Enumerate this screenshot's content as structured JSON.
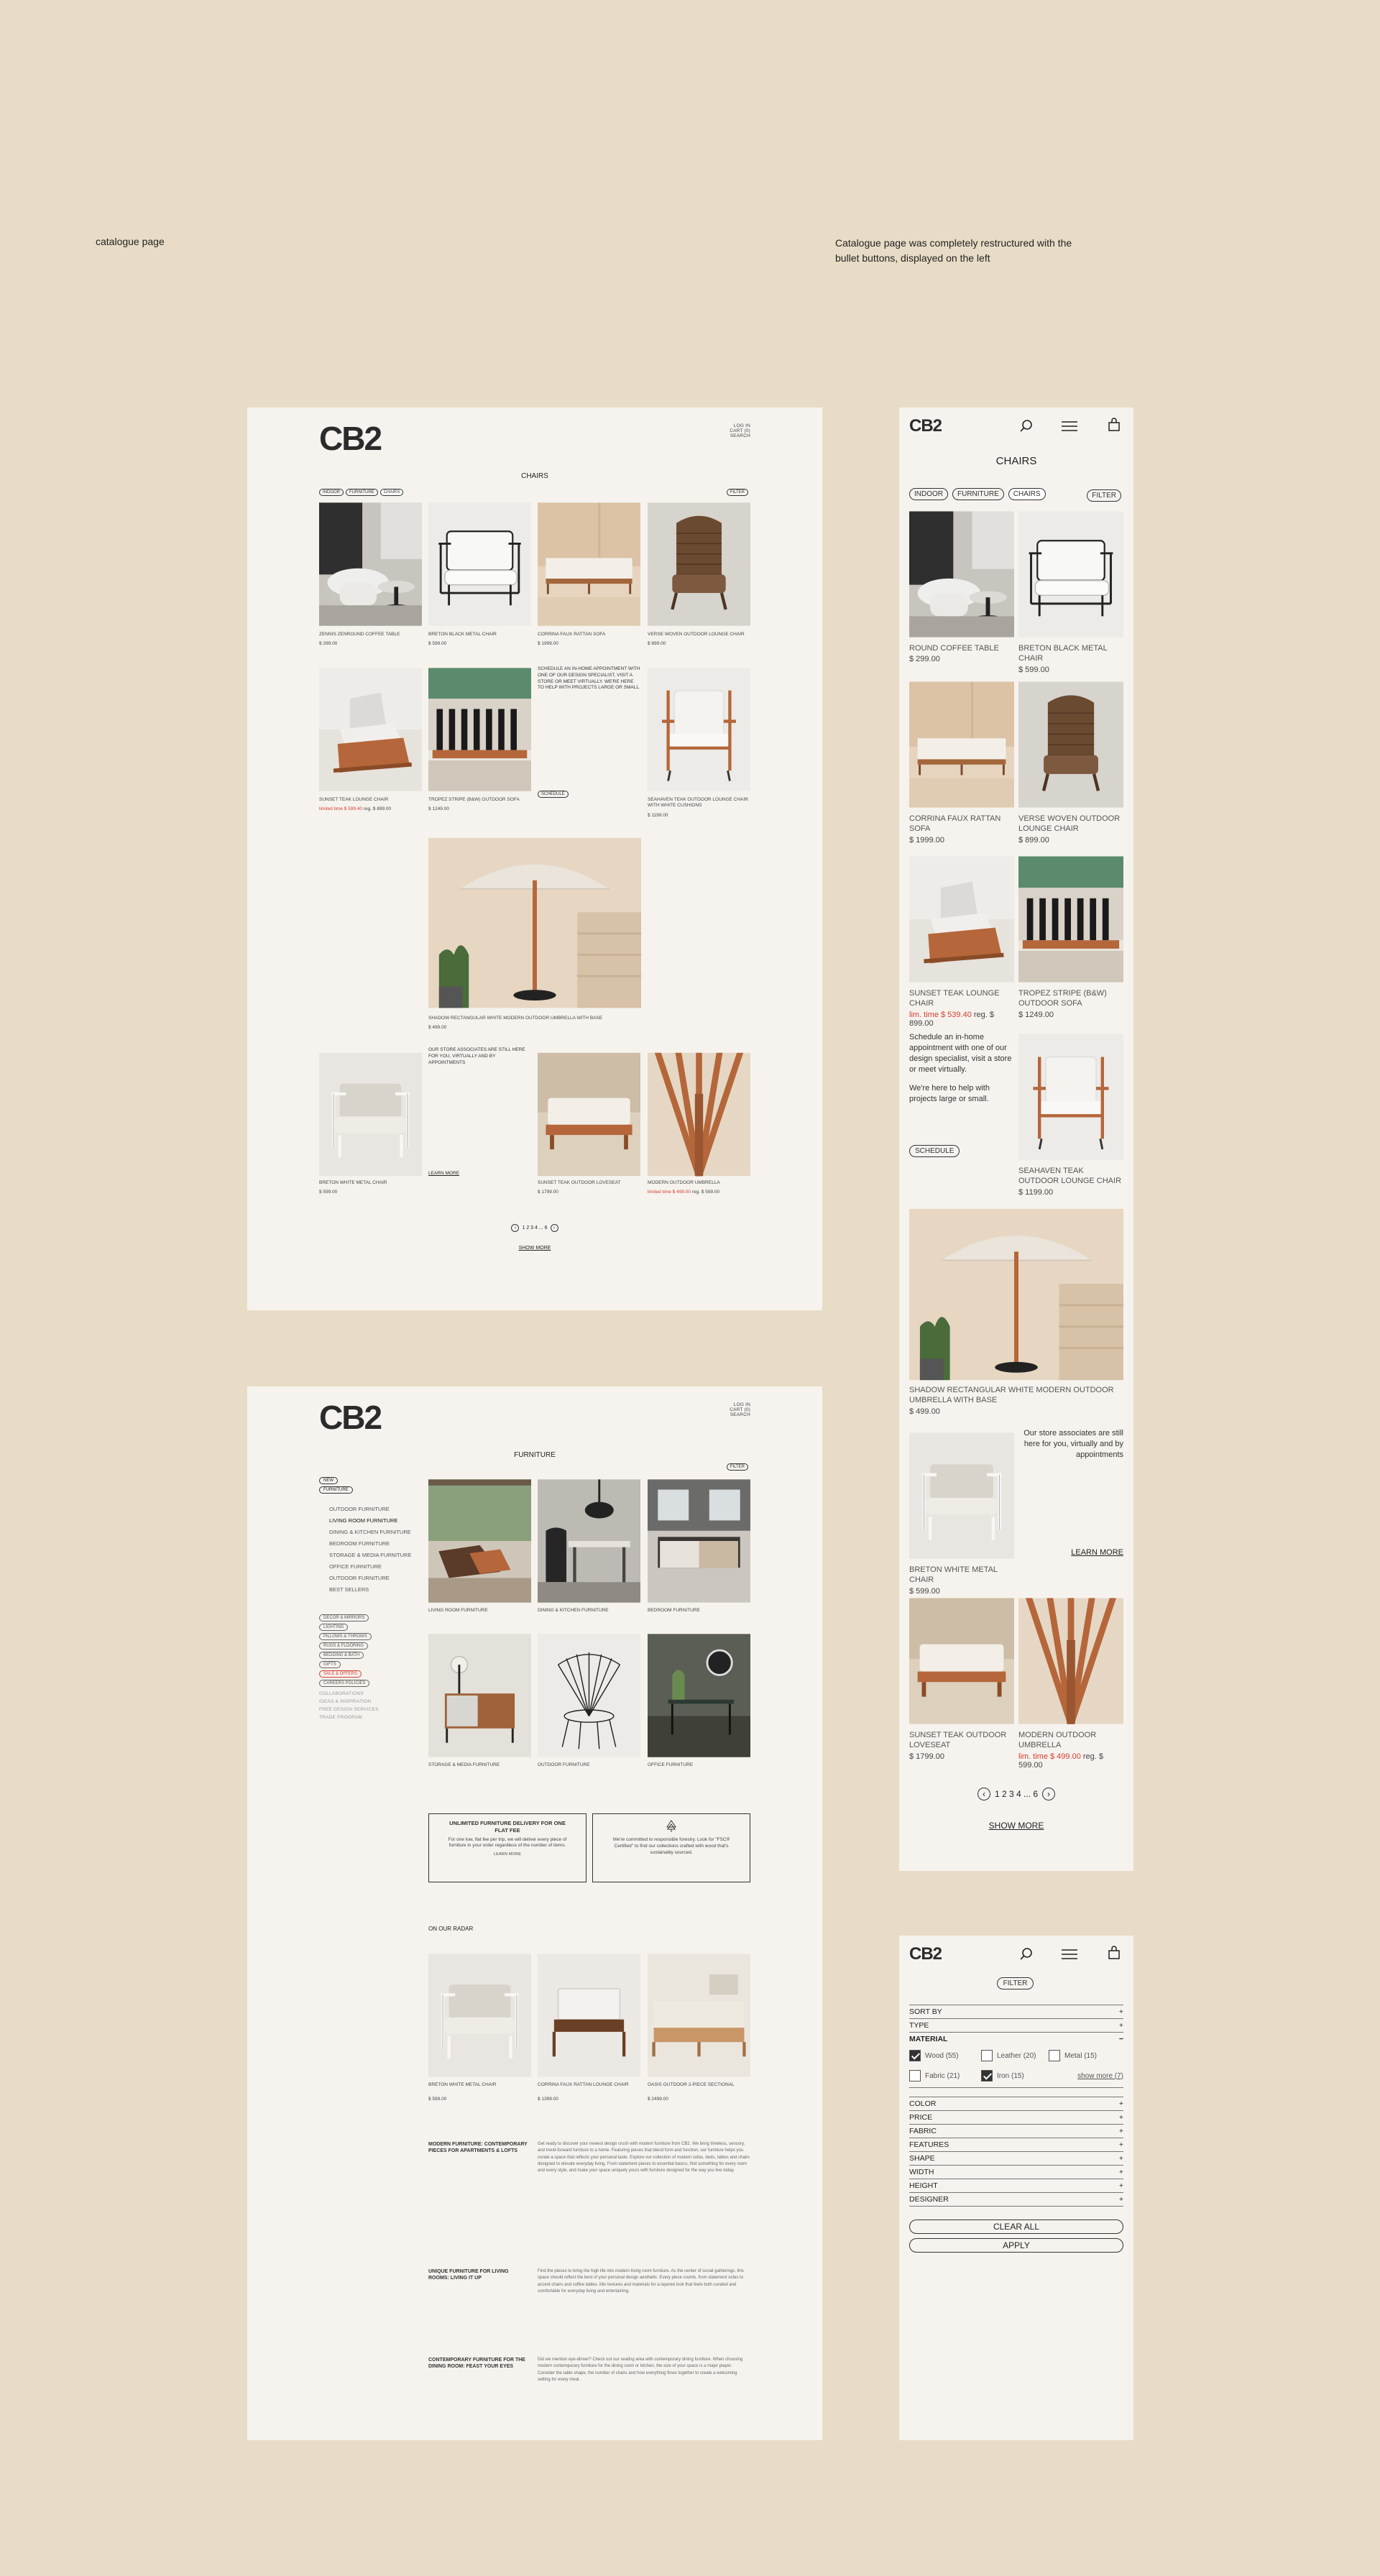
{
  "notes": {
    "left": "catalogue page",
    "right_line1": "Catalogue page was completely restructured with the",
    "right_line2": "bullet buttons, displayed on the left"
  },
  "brand": "CB2",
  "desktop1": {
    "top_links": [
      "LOG IN",
      "CART (0)",
      "SEARCH"
    ],
    "title": "CHAIRS",
    "chips": [
      "INDOOR",
      "FURNITURE",
      "CHAIRS"
    ],
    "filter_label": "FILTER",
    "products": [
      {
        "name": "ZENNIS ZENROUND COFFEE TABLE",
        "price": "$ 299.00"
      },
      {
        "name": "BRETON BLACK METAL CHAIR",
        "price": "$ 599.00"
      },
      {
        "name": "CORRINA FAUX RATTAN SOFA",
        "price": "$ 1999.00"
      },
      {
        "name": "VERSE WOVEN OUTDOOR LOUNGE CHAIR",
        "price": "$ 899.00"
      },
      {
        "name": "SUNSET TEAK LOUNGE CHAIR",
        "price_sale": "limited time $ 599.40",
        "price_reg": "reg. $ 899.00"
      },
      {
        "name": "TROPEZ STRIPE (B&W) OUTDOOR SOFA",
        "price": "$ 1249.00"
      },
      {
        "name": "SEAHAVEN TEAK OUTDOOR LOUNGE CHAIR WITH WHITE CUSHIONS",
        "price": "$ 1199.00"
      },
      {
        "name": "SHADOW RECTANGULAR WHITE MODERN OUTDOOR UMBRELLA WITH BASE",
        "price": "$ 499.00"
      },
      {
        "name": "BRETON WHITE METAL CHAIR",
        "price": "$ 599.00"
      },
      {
        "name": "SUNSET TEAK OUTDOOR LOVESEAT",
        "price": "$ 1799.00"
      },
      {
        "name": "MODERN OUTDOOR UMBRELLA",
        "price_sale": "limited time $ 499.00",
        "price_reg": "reg. $ 599.00"
      }
    ],
    "schedule_text": "SCHEDULE AN IN-HOME APPOINTMENT WITH ONE OF OUR DESIGN SPECIALIST, VISIT A STORE OR MEET VIRTUALLY. WE'RE HERE TO HELP WITH PROJECTS LARGE OR SMALL.",
    "schedule_button": "SCHEDULE",
    "associates_text": "OUR STORE ASSOCIATES ARE STILL HERE FOR YOU, VIRTUALLY AND BY APPOINTMENTS",
    "learn_more": "LEARN MORE",
    "pagination": "1 2 3 4 ... 6",
    "show_more": "SHOW MORE"
  },
  "desktop2": {
    "top_links": [
      "LOG IN",
      "CART (0)",
      "SEARCH"
    ],
    "title": "FURNITURE",
    "filter_label": "FILTER",
    "side_pills_top": [
      "NEW",
      "FURNITURE"
    ],
    "side_cats": [
      "OUTDOOR FURNITURE",
      "LIVING ROOM FURNITURE",
      "DINING & KITCHEN FURNITURE",
      "BEDROOM FURNITURE",
      "STORAGE & MEDIA FURNITURE",
      "OFFICE FURNITURE",
      "OUTDOOR FURNITURE",
      "BEST SELLERS"
    ],
    "side_pills": [
      "DECOR & MIRRORS",
      "LIGHTING",
      "PILLOWS & THROWS",
      "RUGS & FLOORING",
      "BEDDING & BATH",
      "GIFTS",
      "SALE & OFFERS",
      "CAREERS POLICIES"
    ],
    "side_links": [
      "COLLABORATIONS",
      "IDEAS & INSPIRATION",
      "FREE DESIGN SERVICES",
      "TRADE PROGRAM"
    ],
    "categories": [
      "LIVING ROOM FURNITURE",
      "DINING & KITCHEN FURNITURE",
      "BEDROOM FURNITURE",
      "STORAGE & MEDIA FURNITURE",
      "OUTDOOR FURNITURE",
      "OFFICE FURNITURE"
    ],
    "promo1_title": "UNLIMITED FURNITURE DELIVERY FOR ONE FLAT FEE",
    "promo1_body": "For one low, flat fee per trip, we will deliver every piece of furniture in your order regardless of the number of items.",
    "promo1_link": "LEARN MORE",
    "promo2_body": "We're committed to responsible forestry. Look for \"FSC® Certified\" to find our collections crafted with wood that's sustainably sourced.",
    "radar_title": "ON OUR RADAR",
    "radar": [
      {
        "name": "BRETON WHITE METAL CHAIR",
        "price": "$ 599.00"
      },
      {
        "name": "CORRINA FAUX RATTAN LOUNGE CHAIR",
        "price": "$ 1399.00"
      },
      {
        "name": "OASIS OUTDOOR 2-PIECE SECTIONAL",
        "price": "$ 2499.00"
      }
    ],
    "seo": [
      {
        "head": "MODERN FURNITURE: CONTEMPORARY PIECES FOR APARTMENTS & LOFTS",
        "body": "Get ready to discover your newest design crush with modern furniture from CB2. We bring timeless, sensory, and trend-forward furniture to a home. Featuring pieces that blend form and function, our furniture helps you curate a space that reflects your personal taste. Explore our collection of modern sofas, beds, tables and chairs designed to elevate everyday living. From statement pieces to essential basics, find something for every room and every style, and make your space uniquely yours with furniture designed for the way you live today."
      },
      {
        "head": "UNIQUE FURNITURE FOR LIVING ROOMS: LIVING IT UP",
        "body": "Find the pieces to bring the high life into modern living room furniture. As the center of social gatherings, this space should reflect the best of your personal design aesthetic. Every piece counts, from statement sofas to accent chairs and coffee tables. Mix textures and materials for a layered look that feels both curated and comfortable for everyday living and entertaining."
      },
      {
        "head": "CONTEMPORARY FURNITURE FOR THE DINING ROOM: FEAST YOUR EYES",
        "body": "Did we mention eye-dinner? Check out our seating area with contemporary dining furniture. When choosing modern contemporary furniture for the dining room or kitchen, the size of your space is a major player. Consider the table shape, the number of chairs and how everything flows together to create a welcoming setting for every meal."
      }
    ]
  },
  "mobile1": {
    "title": "CHAIRS",
    "chips": [
      "INDOOR",
      "FURNITURE",
      "CHAIRS"
    ],
    "filter_label": "FILTER",
    "products": [
      {
        "name": "ROUND COFFEE TABLE",
        "price": "$ 299.00"
      },
      {
        "name": "BRETON BLACK METAL CHAIR",
        "price": "$ 599.00"
      },
      {
        "name": "CORRINA FAUX RATTAN SOFA",
        "price": "$ 1999.00"
      },
      {
        "name": "VERSE WOVEN OUTDOOR LOUNGE CHAIR",
        "price": "$ 899.00"
      },
      {
        "name": "SUNSET TEAK LOUNGE CHAIR",
        "price_sale": "lim. time $ 539.40",
        "price_reg": "reg. $ 899.00"
      },
      {
        "name": "TROPEZ STRIPE (B&W) OUTDOOR SOFA",
        "price": "$ 1249.00"
      },
      {
        "name": "SEAHAVEN TEAK OUTDOOR LOUNGE CHAIR",
        "price": "$ 1199.00"
      },
      {
        "name": "SHADOW RECTANGULAR WHITE MODERN OUTDOOR UMBRELLA WITH BASE",
        "price": "$ 499.00"
      },
      {
        "name": "BRETON WHITE METAL CHAIR",
        "price": "$ 599.00"
      },
      {
        "name": "SUNSET TEAK OUTDOOR LOVESEAT",
        "price": "$ 1799.00"
      },
      {
        "name": "MODERN OUTDOOR UMBRELLA",
        "price_sale": "lim. time $ 499.00",
        "price_reg": "reg. $ 599.00"
      }
    ],
    "schedule_text1": "Schedule an in-home appointment with one of our design specialist, visit a store or meet virtually.",
    "schedule_text2": "We're here to help with projects large or small.",
    "schedule_button": "SCHEDULE",
    "associates_text": "Our store associates are still here for you, virtually and by appointments",
    "learn_more": "LEARN MORE",
    "pagination": "1 2 3 4 ... 6",
    "show_more": "SHOW MORE"
  },
  "mobile2": {
    "filter_label": "FILTER",
    "rows_top": [
      "SORT BY",
      "TYPE"
    ],
    "material_label": "MATERIAL",
    "materials": [
      {
        "label": "Wood (55)",
        "checked": true
      },
      {
        "label": "Leather (20)",
        "checked": false
      },
      {
        "label": "Metal (15)",
        "checked": false
      },
      {
        "label": "Fabric (21)",
        "checked": false
      },
      {
        "label": "Iron (15)",
        "checked": true
      }
    ],
    "show_more": "show more (7)",
    "rows": [
      "COLOR",
      "PRICE",
      "FABRIC",
      "FEATURES",
      "SHAPE",
      "WIDTH",
      "HEIGHT",
      "DESIGNER"
    ],
    "clear_all": "CLEAR ALL",
    "apply": "APPLY"
  },
  "colors": {
    "background": "#e8dcc6",
    "board": "#f6f3ee",
    "sale": "#d43d2f",
    "teak": "#b5663a"
  }
}
